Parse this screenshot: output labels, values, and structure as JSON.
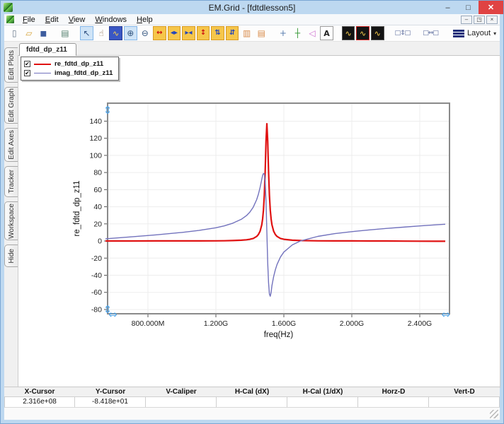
{
  "window": {
    "title": "EM.Grid - [fdtdlesson5]"
  },
  "menu": {
    "items": [
      "File",
      "Edit",
      "View",
      "Windows",
      "Help"
    ]
  },
  "toolbar": {
    "layout_label": "Layout",
    "layout_caret": "▾",
    "buttons": [
      {
        "name": "new-file-icon",
        "glyph": "▯",
        "fg": "#6b7b8d"
      },
      {
        "name": "open-folder-icon",
        "glyph": "▱",
        "fg": "#d7a43b"
      },
      {
        "name": "save-icon",
        "glyph": "◼",
        "fg": "#3d5d9e"
      },
      {
        "name": "print-icon",
        "glyph": "▤",
        "fg": "#55806e",
        "gap": true
      },
      {
        "name": "select-arrow-icon",
        "glyph": "↖",
        "fg": "#2f4f7f",
        "pressed": true,
        "gap": true
      },
      {
        "name": "pan-hand-icon",
        "glyph": "☝",
        "fg": "#8a6d4f"
      },
      {
        "name": "zoom-window-icon",
        "glyph": "∿",
        "fg": "#ffd34d",
        "cls": "dark-blue"
      },
      {
        "name": "zoom-in-icon",
        "glyph": "⊕",
        "fg": "#33557f",
        "pressed": true
      },
      {
        "name": "zoom-out-icon",
        "glyph": "⊖",
        "fg": "#33557f"
      },
      {
        "name": "expand-x-icon",
        "glyph": "↔",
        "fg": "#cc1111",
        "cls": "yellow"
      },
      {
        "name": "scale-x-out-icon",
        "glyph": "◂▸",
        "fg": "#2244bb",
        "cls": "yellow"
      },
      {
        "name": "scale-x-in-icon",
        "glyph": "▸◂",
        "fg": "#2244bb",
        "cls": "yellow"
      },
      {
        "name": "expand-y-icon",
        "glyph": "↕",
        "fg": "#cc1111",
        "cls": "yellow"
      },
      {
        "name": "scale-y-out-icon",
        "glyph": "⇅",
        "fg": "#2244bb",
        "cls": "yellow"
      },
      {
        "name": "scale-y-in-icon",
        "glyph": "⇵",
        "fg": "#2244bb",
        "cls": "yellow"
      },
      {
        "name": "split-vertical-icon",
        "glyph": "▥",
        "fg": "#d98c4a"
      },
      {
        "name": "split-horizontal-icon",
        "glyph": "▤",
        "fg": "#d98c4a"
      },
      {
        "name": "crosshair-icon",
        "glyph": "+",
        "fg": "#5b7fb0",
        "gap": true
      },
      {
        "name": "tracker-axes-icon",
        "glyph": "┼",
        "fg": "#3a9a3a"
      },
      {
        "name": "caliper-icon",
        "glyph": "◁",
        "fg": "#cf6fd0"
      },
      {
        "name": "text-annotation-icon",
        "glyph": "A",
        "fg": "#222222",
        "cls": "boxed"
      },
      {
        "name": "copy-graph-icon",
        "glyph": "∿",
        "fg": "#ffd34d",
        "cls": "dark",
        "gap": true
      },
      {
        "name": "graph-style-icon",
        "glyph": "∿",
        "fg": "#ffd34d",
        "cls": "dark red-border"
      },
      {
        "name": "new-graph-icon",
        "glyph": "∿",
        "fg": "#ffd34d",
        "cls": "dark"
      },
      {
        "name": "equal-v-spacing-icon",
        "glyph": "□⇕□",
        "fg": "#556699",
        "cls": "wide",
        "gap": true
      },
      {
        "name": "equal-h-spacing-icon",
        "glyph": "□⇔□",
        "fg": "#556699",
        "cls": "wide",
        "gap": true
      }
    ]
  },
  "tabs": {
    "active": "fdtd_dp_z11"
  },
  "sidebar": {
    "tabs": [
      {
        "label": "Edit Plots",
        "h": 50
      },
      {
        "label": "Edit Graph",
        "h": 52
      },
      {
        "label": "Edit Axes",
        "h": 48
      },
      {
        "label": "Tracker",
        "h": 44
      },
      {
        "label": "Workspace",
        "h": 55
      },
      {
        "label": "Hide",
        "h": 32
      }
    ]
  },
  "chart_data": {
    "type": "line",
    "title": "",
    "xlabel": "freq(Hz)",
    "ylabel": "re_fdtd_dp_z11",
    "x_unit": "GHz",
    "xlim": [
      0.5625,
      2.575
    ],
    "ylim": [
      -85,
      161
    ],
    "grid": true,
    "legend_position": "top-left-outside",
    "x_ticks": [
      {
        "value": 0.8,
        "label": "800.000M"
      },
      {
        "value": 1.2,
        "label": "1.200G"
      },
      {
        "value": 1.6,
        "label": "1.600G"
      },
      {
        "value": 2.0,
        "label": "2.000G"
      },
      {
        "value": 2.4,
        "label": "2.400G"
      }
    ],
    "y_ticks": [
      -80,
      -60,
      -40,
      -20,
      0,
      20,
      40,
      60,
      80,
      100,
      120,
      140
    ],
    "x": [
      0.55,
      0.7,
      0.85,
      1.0,
      1.1,
      1.2,
      1.25,
      1.3,
      1.35,
      1.38,
      1.4,
      1.42,
      1.44,
      1.45,
      1.46,
      1.47,
      1.475,
      1.48,
      1.485,
      1.49,
      1.495,
      1.5,
      1.505,
      1.51,
      1.515,
      1.52,
      1.525,
      1.53,
      1.54,
      1.55,
      1.56,
      1.58,
      1.6,
      1.65,
      1.7,
      1.8,
      1.9,
      2.0,
      2.1,
      2.2,
      2.3,
      2.4,
      2.5,
      2.55
    ],
    "series": [
      {
        "name": "re_fdtd_dp_z11",
        "color": "#e01212",
        "width": 2.2,
        "checked": true,
        "y": [
          0,
          0,
          0.1,
          0.1,
          0.1,
          0.2,
          0.3,
          0.5,
          0.9,
          1.4,
          2.0,
          3.0,
          5.3,
          7.5,
          11.3,
          18.9,
          25.7,
          36.3,
          53.5,
          80.8,
          116.7,
          137,
          116.7,
          80.8,
          53.5,
          36.3,
          25.7,
          18.9,
          11.3,
          7.5,
          5.3,
          3.0,
          2.0,
          0.9,
          0.5,
          0.2,
          0.1,
          0.1,
          0,
          0,
          -0.1,
          -0.2,
          -0.3,
          -0.3
        ]
      },
      {
        "name": "imag_fdtd_dp_z11",
        "color": "#7272bd",
        "width": 1.4,
        "checked": true,
        "y": [
          2.6,
          4.8,
          7.2,
          10.0,
          12.3,
          15.5,
          17.7,
          20.8,
          25.4,
          29.7,
          33.8,
          39.6,
          48.3,
          54.5,
          62.4,
          71.9,
          76.6,
          78.9,
          78.2,
          69.8,
          46.5,
          10.5,
          -25.6,
          -48.9,
          -62,
          -64.5,
          -60,
          -52,
          -41.5,
          -33.6,
          -27.4,
          -18.7,
          -12.9,
          -4.5,
          0.2,
          5.4,
          8.6,
          10.9,
          12.9,
          14.6,
          16.1,
          17.6,
          18.9,
          19.6
        ]
      }
    ]
  },
  "statusbar": {
    "columns": [
      {
        "label": "X-Cursor",
        "value": "2.316e+08"
      },
      {
        "label": "Y-Cursor",
        "value": "-8.418e+01"
      },
      {
        "label": "V-Caliper",
        "value": ""
      },
      {
        "label": "H-Cal (dX)",
        "value": ""
      },
      {
        "label": "H-Cal (1/dX)",
        "value": ""
      },
      {
        "label": "Horz-D",
        "value": ""
      },
      {
        "label": "Vert-D",
        "value": ""
      }
    ]
  },
  "titlebar_buttons": {
    "minimize": "–",
    "maximize": "□",
    "close": "✕"
  },
  "mdi_buttons": {
    "minimize": "–",
    "restore": "◳",
    "close": "×"
  },
  "colors": {
    "titlebar": "#bdd8f0",
    "close_button": "#e04343",
    "grid": "#ededed",
    "frame": "#8a8a8a",
    "cursor": "#4da3e8"
  }
}
